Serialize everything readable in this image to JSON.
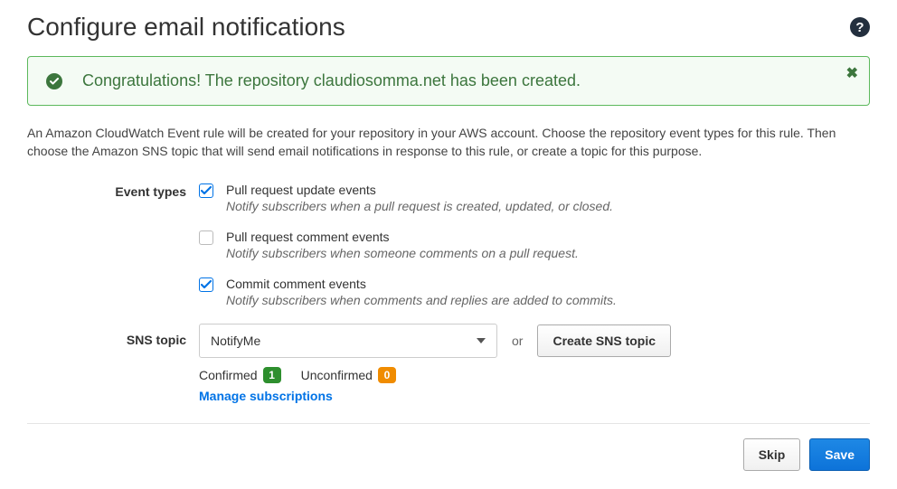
{
  "header": {
    "title": "Configure email notifications"
  },
  "alert": {
    "message": "Congratulations! The repository claudiosomma.net has been created."
  },
  "description": "An Amazon CloudWatch Event rule will be created for your repository in your AWS account. Choose the repository event types for this rule. Then choose the Amazon SNS topic that will send email notifications in response to this rule, or create a topic for this purpose.",
  "event_types": {
    "label": "Event types",
    "items": [
      {
        "checked": true,
        "title": "Pull request update events",
        "desc": "Notify subscribers when a pull request is created, updated, or closed."
      },
      {
        "checked": false,
        "title": "Pull request comment events",
        "desc": "Notify subscribers when someone comments on a pull request."
      },
      {
        "checked": true,
        "title": "Commit comment events",
        "desc": "Notify subscribers when comments and replies are added to commits."
      }
    ]
  },
  "sns": {
    "label": "SNS topic",
    "selected": "NotifyMe",
    "or": "or",
    "create_button": "Create SNS topic",
    "confirmed_label": "Confirmed",
    "confirmed_count": "1",
    "unconfirmed_label": "Unconfirmed",
    "unconfirmed_count": "0",
    "manage_link": "Manage subscriptions"
  },
  "footer": {
    "skip": "Skip",
    "save": "Save"
  }
}
